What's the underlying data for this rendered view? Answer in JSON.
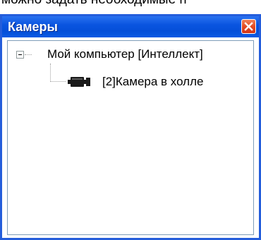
{
  "background_text": "можно задать необходимые п",
  "window": {
    "title": "Камеры",
    "close_icon": "close-icon",
    "colors": {
      "titlebar": "#0a55e0",
      "close": "#e2471f",
      "border": "#245ddb"
    }
  },
  "tree": {
    "root": {
      "label": "Мой компьютер [Интеллект]",
      "expanded": true,
      "expander_icon": "minus-box-icon"
    },
    "children": [
      {
        "label": "[2]Камера в холле",
        "icon": "camera-icon"
      }
    ]
  }
}
